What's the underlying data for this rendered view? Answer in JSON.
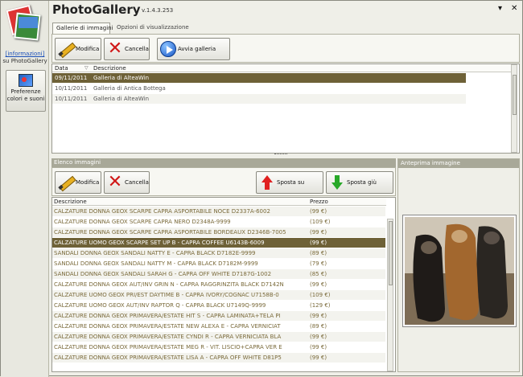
{
  "app": {
    "title": "PhotoGallery",
    "version": "v.1.4.3.253",
    "controls": [
      "▾",
      "✕"
    ]
  },
  "sidebar": {
    "info_link": "[informazioni]",
    "info_sub": "su PhotoGallery",
    "preferences_label": "Preferenze colori e suoni"
  },
  "tabs": [
    {
      "label": "Gallerie di immagini",
      "active": true
    },
    {
      "label": "Opzioni di visualizzazione",
      "active": false
    }
  ],
  "gallery_toolbar": {
    "edit_label": "Modifica",
    "delete_label": "Cancella",
    "start_label": "Avvia galleria"
  },
  "gallery_table": {
    "columns": [
      "Data",
      "Descrizione"
    ],
    "rows": [
      {
        "date": "09/11/2011",
        "description": "Galleria di AlteaWin",
        "selected": true
      },
      {
        "date": "10/11/2011",
        "description": "Galleria di Antica Bottega",
        "selected": false
      },
      {
        "date": "10/11/2011",
        "description": "Galleria di AlteaWin",
        "selected": false
      }
    ]
  },
  "images_section": {
    "title": "Elenco immagini",
    "edit_label": "Modifica",
    "delete_label": "Cancella",
    "move_up_label": "Sposta su",
    "move_down_label": "Sposta giù",
    "columns": [
      "Descrizione",
      "Prezzo"
    ],
    "rows": [
      {
        "description": "CALZATURE DONNA GEOX SCARPE CAPRA ASPORTABILE NOCE D2337A-6002",
        "price": "(99 €)"
      },
      {
        "description": "CALZATURE DONNA GEOX SCARPE CAPRA NERO D2348A-9999",
        "price": "(109 €)"
      },
      {
        "description": "CALZATURE DONNA GEOX SCARPE CAPRA ASPORTABILE BORDEAUX D2346B-7005",
        "price": "(99 €)"
      },
      {
        "description": "CALZATURE UOMO GEOX SCARPE SET UP B - CAPRA COFFEE U6143B-6009",
        "price": "(99 €)",
        "selected": true
      },
      {
        "description": "SANDALI DONNA GEOX SANDALI NATTY E - CAPRA BLACK D7182E-9999",
        "price": "(89 €)"
      },
      {
        "description": "SANDALI DONNA GEOX SANDALI NATTY M - CAPRA BLACK D7182M-9999",
        "price": "(79 €)"
      },
      {
        "description": "SANDALI DONNA GEOX SANDALI SARAH G - CAPRA OFF WHITE D7187G-1002",
        "price": "(85 €)"
      },
      {
        "description": "CALZATURE DONNA GEOX AUT/INV GRIN N - CAPRA RAGGRINZITA BLACK D7142N",
        "price": "(99 €)"
      },
      {
        "description": "CALZATURE UOMO GEOX PRI/EST DAYTIME B - CAPRA IVORY/COGNAC U7158B-0",
        "price": "(109 €)"
      },
      {
        "description": "CALZATURE UOMO GEOX AUT/INV RAPTOR Q - CAPRA BLACK U7149Q-9999",
        "price": "(129 €)"
      },
      {
        "description": "CALZATURE DONNA GEOX PRIMAVERA/ESTATE HIT S - CAPRA LAMINATA+TELA PI",
        "price": "(99 €)"
      },
      {
        "description": "CALZATURE DONNA GEOX PRIMAVERA/ESTATE NEW ALEXA E - CAPRA VERNICIAT",
        "price": "(89 €)"
      },
      {
        "description": "CALZATURE DONNA GEOX PRIMAVERA/ESTATE CYNDI R - CAPRA VERNICIATA BLA",
        "price": "(99 €)"
      },
      {
        "description": "CALZATURE DONNA GEOX PRIMAVERA/ESTATE MEG R - VIT. LISCIO+CAPRA VER E",
        "price": "(99 €)"
      },
      {
        "description": "CALZATURE DONNA GEOX PRIMAVERA/ESTATE LISA A - CAPRA OFF WHITE D81P5",
        "price": "(99 €)"
      }
    ]
  },
  "preview": {
    "title": "Anteprima immagine"
  },
  "colors": {
    "selection": "#6e6137",
    "section_bar": "#a8a898",
    "row_text": "#7a6a3a"
  }
}
